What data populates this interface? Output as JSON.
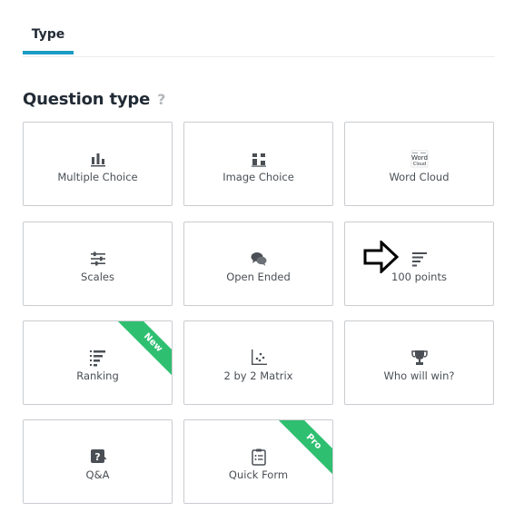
{
  "tabs": [
    {
      "label": "Type"
    }
  ],
  "section": {
    "title": "Question type",
    "help": "?"
  },
  "cards": {
    "multiple_choice": {
      "label": "Multiple Choice"
    },
    "image_choice": {
      "label": "Image Choice"
    },
    "word_cloud": {
      "label": "Word Cloud",
      "icon_text_1": "Word",
      "icon_text_2": "Cloud"
    },
    "scales": {
      "label": "Scales"
    },
    "open_ended": {
      "label": "Open Ended"
    },
    "hundred_points": {
      "label": "100 points"
    },
    "ranking": {
      "label": "Ranking",
      "ribbon": "New"
    },
    "matrix": {
      "label": "2 by 2 Matrix"
    },
    "who_will_win": {
      "label": "Who will win?"
    },
    "qa": {
      "label": "Q&A",
      "icon_text": "?"
    },
    "quick_form": {
      "label": "Quick Form",
      "ribbon": "Pro"
    }
  },
  "colors": {
    "accent": "#1a9ac4",
    "ribbon": "#2fbf71",
    "icon": "#4a4f55"
  }
}
